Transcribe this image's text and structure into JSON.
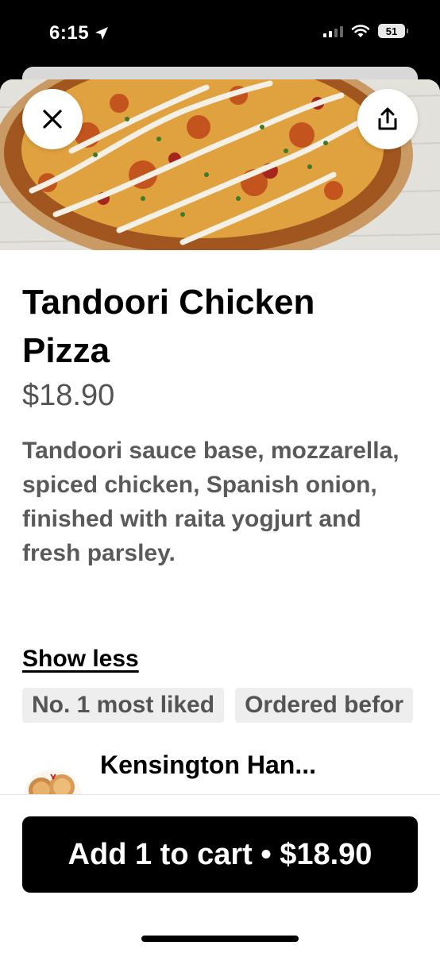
{
  "status_bar": {
    "time": "6:15",
    "battery": "51"
  },
  "item": {
    "title": "Tandoori Chicken Pizza",
    "price": "$18.90",
    "description": "Tandoori sauce base, mozzarella, spiced chicken, Spanish onion, finished with raita yogjurt and fresh parsley.",
    "show_less": "Show less",
    "badges": [
      "No. 1 most liked",
      "Ordered befor"
    ]
  },
  "restaurant": {
    "name": "Kensington Han..."
  },
  "footer": {
    "cart_button": "Add 1 to cart • $18.90"
  }
}
